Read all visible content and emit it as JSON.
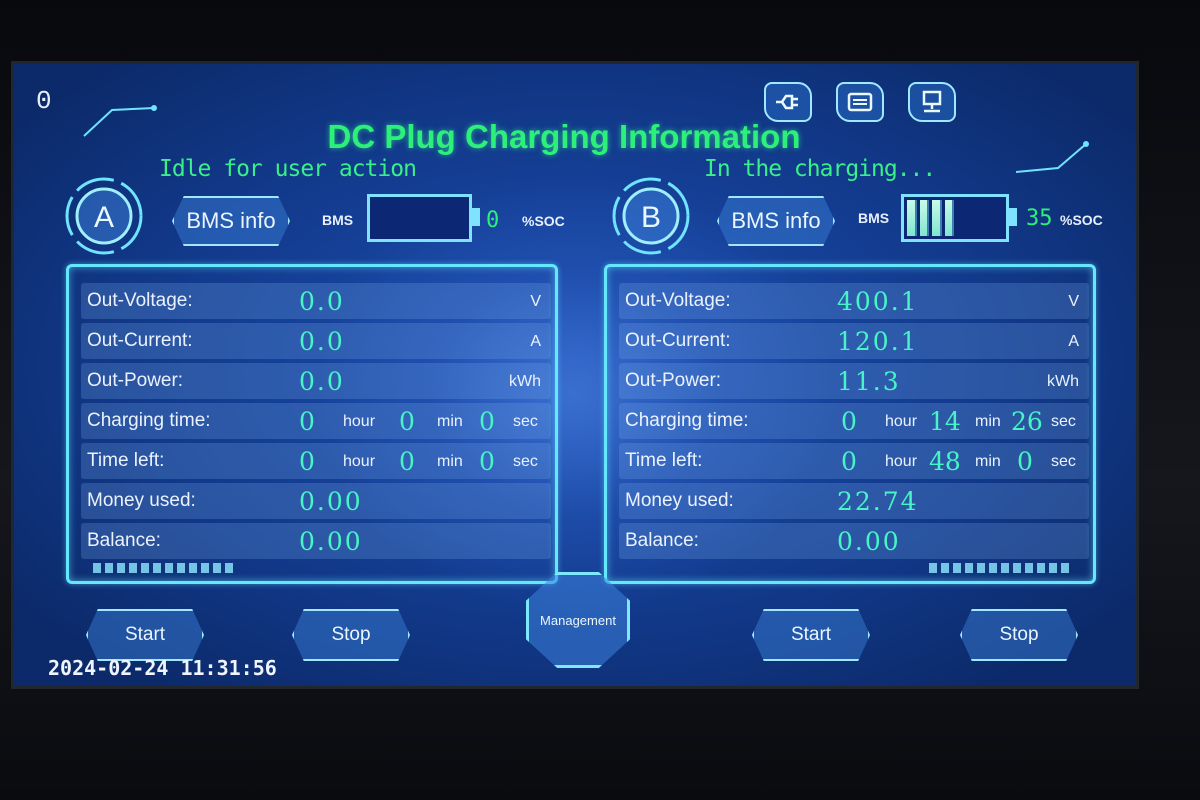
{
  "screen": {
    "corner_number": "0",
    "title": "DC Plug Charging Information",
    "accent_color": "#2cf07a",
    "value_color": "#46f4c6"
  },
  "header_icons": [
    "charging-plug-icon",
    "card-reader-icon",
    "network-icon"
  ],
  "port_a": {
    "badge": "A",
    "status": "Idle for user action",
    "bms_button": "BMS info",
    "bms_label": "BMS",
    "soc_value": "0",
    "soc_percent": 0,
    "soc_unit": "%SOC",
    "rows": {
      "voltage": {
        "label": "Out-Voltage:",
        "value": "0.0",
        "unit": "V"
      },
      "current": {
        "label": "Out-Current:",
        "value": "0.0",
        "unit": "A"
      },
      "power": {
        "label": "Out-Power:",
        "value": "0.0",
        "unit": "kWh"
      },
      "charging_time": {
        "label": "Charging time:",
        "hour": "0",
        "min": "0",
        "sec": "0"
      },
      "time_left": {
        "label": "Time left:",
        "hour": "0",
        "min": "0",
        "sec": "0"
      },
      "money_used": {
        "label": "Money used:",
        "value": "0.00"
      },
      "balance": {
        "label": "Balance:",
        "value": "0.00"
      }
    },
    "start_button": "Start",
    "stop_button": "Stop"
  },
  "port_b": {
    "badge": "B",
    "status": "In the charging...",
    "bms_button": "BMS info",
    "bms_label": "BMS",
    "soc_value": "35",
    "soc_percent": 35,
    "soc_unit": "%SOC",
    "rows": {
      "voltage": {
        "label": "Out-Voltage:",
        "value": "400.1",
        "unit": "V"
      },
      "current": {
        "label": "Out-Current:",
        "value": "120.1",
        "unit": "A"
      },
      "power": {
        "label": "Out-Power:",
        "value": "11.3",
        "unit": "kWh"
      },
      "charging_time": {
        "label": "Charging time:",
        "hour": "0",
        "min": "14",
        "sec": "26"
      },
      "time_left": {
        "label": "Time left:",
        "hour": "0",
        "min": "48",
        "sec": "0"
      },
      "money_used": {
        "label": "Money used:",
        "value": "22.74"
      },
      "balance": {
        "label": "Balance:",
        "value": "0.00"
      }
    },
    "start_button": "Start",
    "stop_button": "Stop"
  },
  "time_units": {
    "hour": "hour",
    "min": "min",
    "sec": "sec"
  },
  "management_button": "Management",
  "datetime": "2024-02-24 11:31:56"
}
